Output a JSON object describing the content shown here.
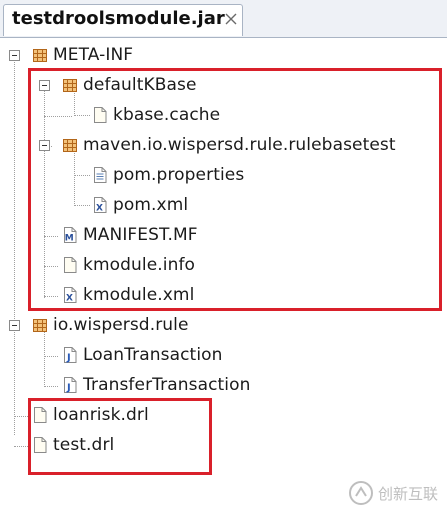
{
  "tab": {
    "title": "testdroolsmodule.jar"
  },
  "tree": {
    "meta_inf": "META-INF",
    "default_kbase": "defaultKBase",
    "kbase_cache": "kbase.cache",
    "maven_folder": "maven.io.wispersd.rule.rulebasetest",
    "pom_properties": "pom.properties",
    "pom_xml": "pom.xml",
    "manifest": "MANIFEST.MF",
    "kmodule_info": "kmodule.info",
    "kmodule_xml": "kmodule.xml",
    "rule_package": "io.wispersd.rule",
    "loan_transaction": "LoanTransaction",
    "transfer_transaction": "TransferTransaction",
    "loanrisk_drl": "loanrisk.drl",
    "test_drl": "test.drl"
  },
  "icons": {
    "package": "package-icon",
    "file": "file-icon",
    "properties": "properties-file-icon",
    "xml": "xml-file-icon",
    "manifest": "manifest-file-icon",
    "java": "java-class-icon"
  },
  "colors": {
    "highlight_box": "#d9202a",
    "package_icon": "#c8781e",
    "java_icon": "#3a6fc8"
  },
  "watermark": {
    "text": "创新互联"
  }
}
